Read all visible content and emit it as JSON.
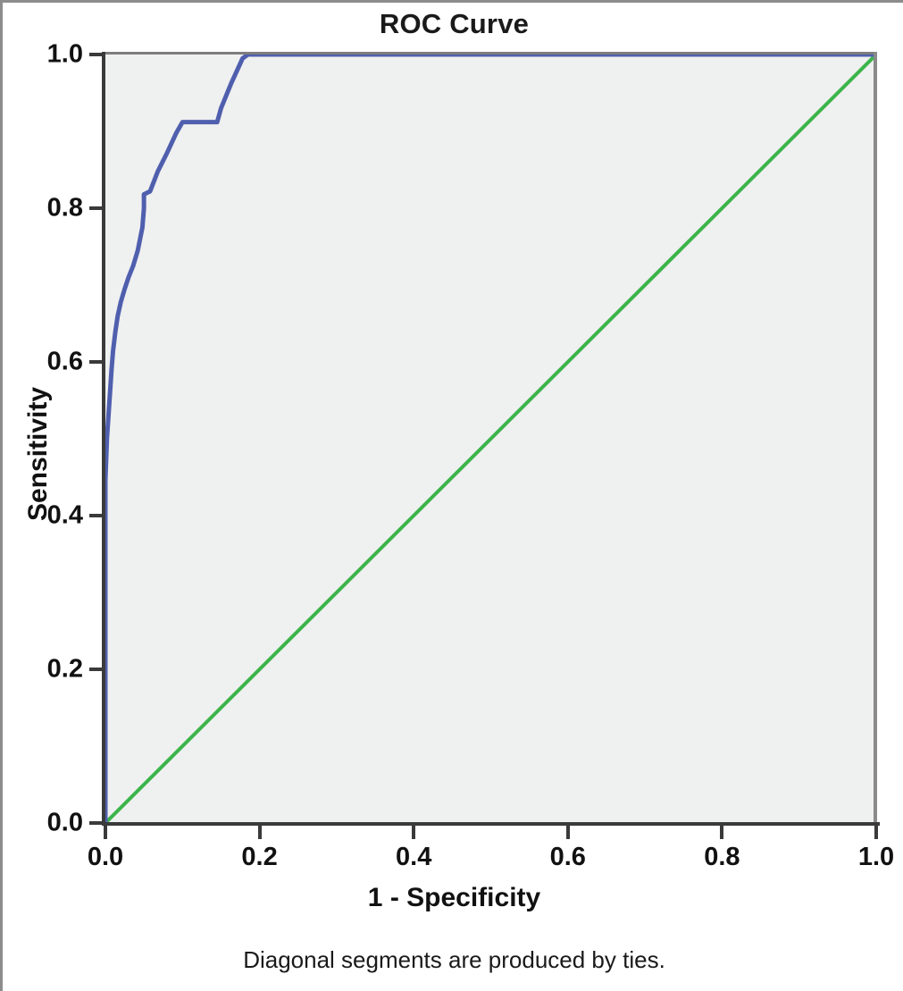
{
  "chart_data": {
    "type": "line",
    "title": "ROC Curve",
    "xlabel": "1 - Specificity",
    "ylabel": "Sensitivity",
    "footnote": "Diagonal segments are produced by ties.",
    "xlim": [
      0.0,
      1.0
    ],
    "ylim": [
      0.0,
      1.0
    ],
    "grid": false,
    "legend": "none",
    "plot_background": "#eff0f0",
    "x_ticks": [
      "0.0",
      "0.2",
      "0.4",
      "0.6",
      "0.8",
      "1.0"
    ],
    "x_tick_values": [
      0.0,
      0.2,
      0.4,
      0.6,
      0.8,
      1.0
    ],
    "y_ticks": [
      "0.0",
      "0.2",
      "0.4",
      "0.6",
      "0.8",
      "1.0"
    ],
    "y_tick_values": [
      0.0,
      0.2,
      0.4,
      0.6,
      0.8,
      1.0
    ],
    "series": [
      {
        "name": "ROC curve",
        "color": "#4f5fae",
        "points": [
          [
            0.0,
            0.0
          ],
          [
            0.0,
            0.445
          ],
          [
            0.002,
            0.5
          ],
          [
            0.004,
            0.53
          ],
          [
            0.006,
            0.56
          ],
          [
            0.008,
            0.59
          ],
          [
            0.01,
            0.615
          ],
          [
            0.013,
            0.64
          ],
          [
            0.016,
            0.66
          ],
          [
            0.02,
            0.678
          ],
          [
            0.025,
            0.695
          ],
          [
            0.03,
            0.71
          ],
          [
            0.036,
            0.725
          ],
          [
            0.042,
            0.745
          ],
          [
            0.048,
            0.775
          ],
          [
            0.05,
            0.8
          ],
          [
            0.05,
            0.818
          ],
          [
            0.058,
            0.822
          ],
          [
            0.068,
            0.848
          ],
          [
            0.08,
            0.872
          ],
          [
            0.092,
            0.898
          ],
          [
            0.1,
            0.912
          ],
          [
            0.145,
            0.912
          ],
          [
            0.15,
            0.93
          ],
          [
            0.163,
            0.962
          ],
          [
            0.178,
            0.995
          ],
          [
            0.185,
            1.0
          ],
          [
            1.0,
            1.0
          ]
        ]
      },
      {
        "name": "Reference line",
        "color": "#3cb44a",
        "points": [
          [
            0.0,
            0.0
          ],
          [
            1.0,
            1.0
          ]
        ]
      }
    ]
  },
  "axis": {
    "y_title": "Sensitivity",
    "x_title": "1 - Specificity"
  },
  "title": "ROC Curve",
  "footnote": "Diagonal segments are produced by ties."
}
